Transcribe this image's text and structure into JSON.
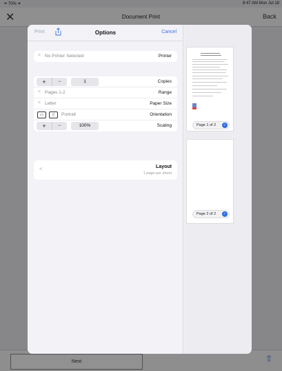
{
  "status": {
    "left": "•• 70% ✶",
    "right": "8:47 AM  Mon Jul 18"
  },
  "background": {
    "title": "Document Print",
    "close_label": "✕",
    "back_label": "Back",
    "next_label": "Next",
    "share_label": "⇧"
  },
  "options": {
    "print_label": "Print",
    "title": "Options",
    "cancel_label": "Cancel",
    "printer": {
      "label": "Printer",
      "value": "No Printer Selected"
    },
    "copies": {
      "label": "Copies",
      "value": "1",
      "plus": "+",
      "minus": "−"
    },
    "range": {
      "label": "Range",
      "value": "Pages 1-2"
    },
    "paper_size": {
      "label": "Paper Size",
      "value": "Letter"
    },
    "orientation": {
      "label": "Orientation",
      "value": "Portrait"
    },
    "scaling": {
      "label": "Scaling",
      "value": "100%",
      "plus": "+",
      "minus": "−"
    },
    "layout": {
      "label": "Layout",
      "sub": "1 page per sheet"
    },
    "chevron": "<"
  },
  "preview": {
    "pages": [
      {
        "label": "Page 1 of 2",
        "check": "✓"
      },
      {
        "label": "Page 2 of 2",
        "check": "✓"
      }
    ]
  }
}
